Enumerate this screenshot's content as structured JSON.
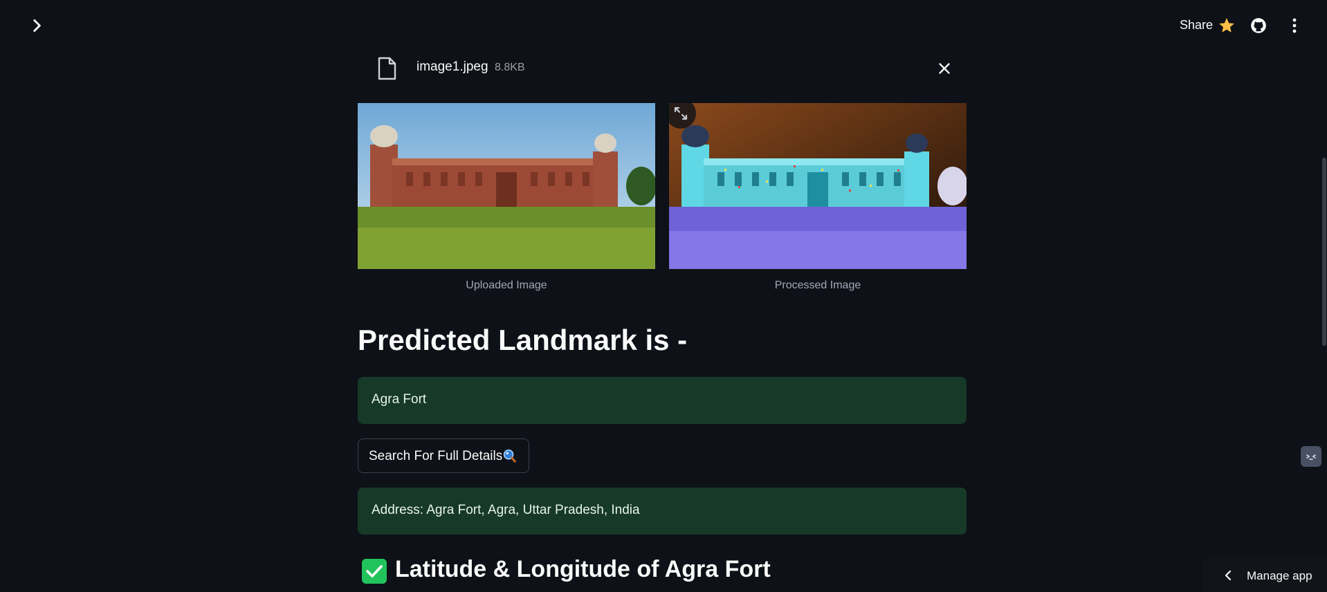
{
  "header": {
    "share_label": "Share",
    "icons": [
      "chevron-right-icon",
      "star-icon",
      "github-icon",
      "more-vertical-icon"
    ]
  },
  "file": {
    "name": "image1.jpeg",
    "size": "8.8KB"
  },
  "images": {
    "uploaded_caption": "Uploaded Image",
    "processed_caption": "Processed Image"
  },
  "prediction": {
    "heading": "Predicted Landmark is -",
    "landmark": "Agra Fort"
  },
  "search_button": {
    "label": "Search For Full Details",
    "icon": "magnifier-icon"
  },
  "address": {
    "text": "Address: Agra Fort, Agra, Uttar Pradesh, India"
  },
  "location": {
    "heading": "Latitude & Longitude of Agra Fort"
  },
  "footer": {
    "manage_label": "Manage app"
  },
  "colors": {
    "background": "#0e1117",
    "success_bg": "#173928",
    "check_green": "#21c35c",
    "star_yellow": "#ffbd45"
  }
}
